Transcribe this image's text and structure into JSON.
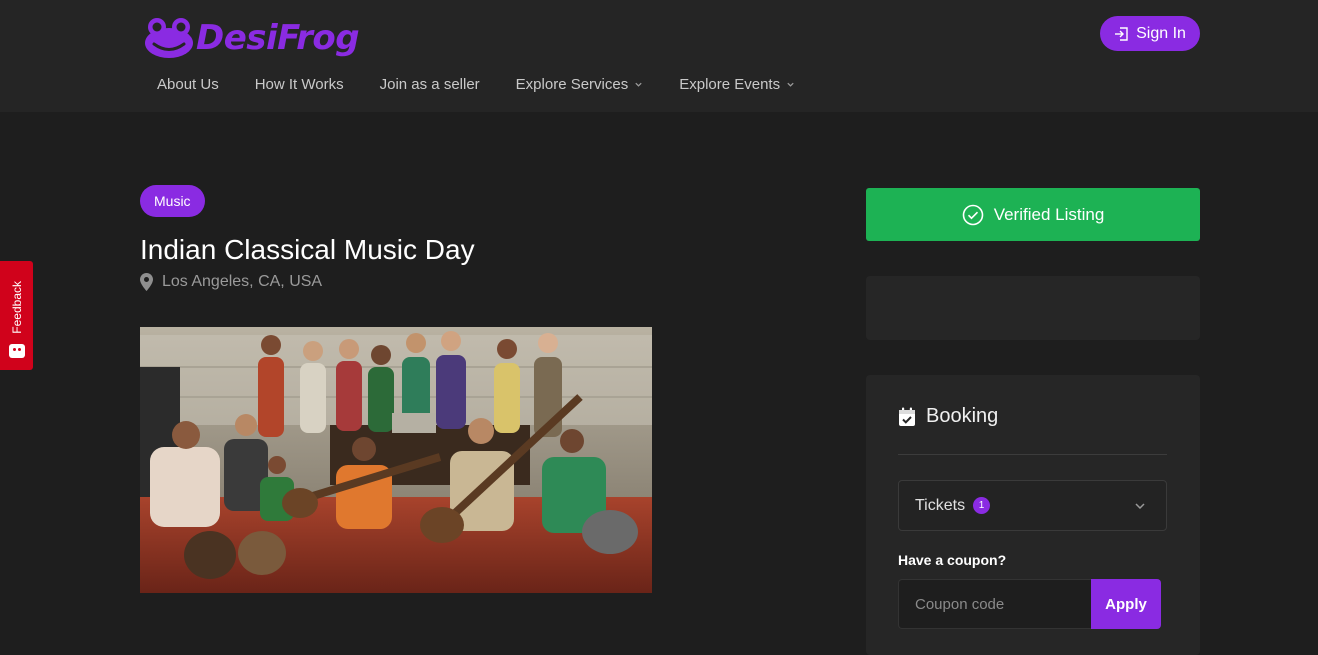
{
  "brand": {
    "name": "DesiFrog",
    "color": "#8a2be2",
    "logo_icon": "frog-face-icon"
  },
  "header": {
    "signin_label": "Sign In",
    "signin_icon": "sign-in-icon",
    "nav": [
      {
        "label": "About Us"
      },
      {
        "label": "How It Works"
      },
      {
        "label": "Join as a seller"
      },
      {
        "label": "Explore Services",
        "dropdown": true
      },
      {
        "label": "Explore Events",
        "dropdown": true
      }
    ]
  },
  "feedback": {
    "label": "Feedback",
    "color": "#d0021b"
  },
  "event": {
    "category": "Music",
    "title": "Indian Classical Music Day",
    "location": "Los Angeles, CA, USA",
    "image_alt": "Group photo of musicians with Indian classical instruments"
  },
  "sidebar": {
    "verified_label": "Verified Listing",
    "verified_color": "#1db254",
    "booking": {
      "heading": "Booking",
      "tickets_label": "Tickets",
      "tickets_count": "1",
      "coupon_label": "Have a coupon?",
      "coupon_placeholder": "Coupon code",
      "apply_label": "Apply"
    }
  }
}
